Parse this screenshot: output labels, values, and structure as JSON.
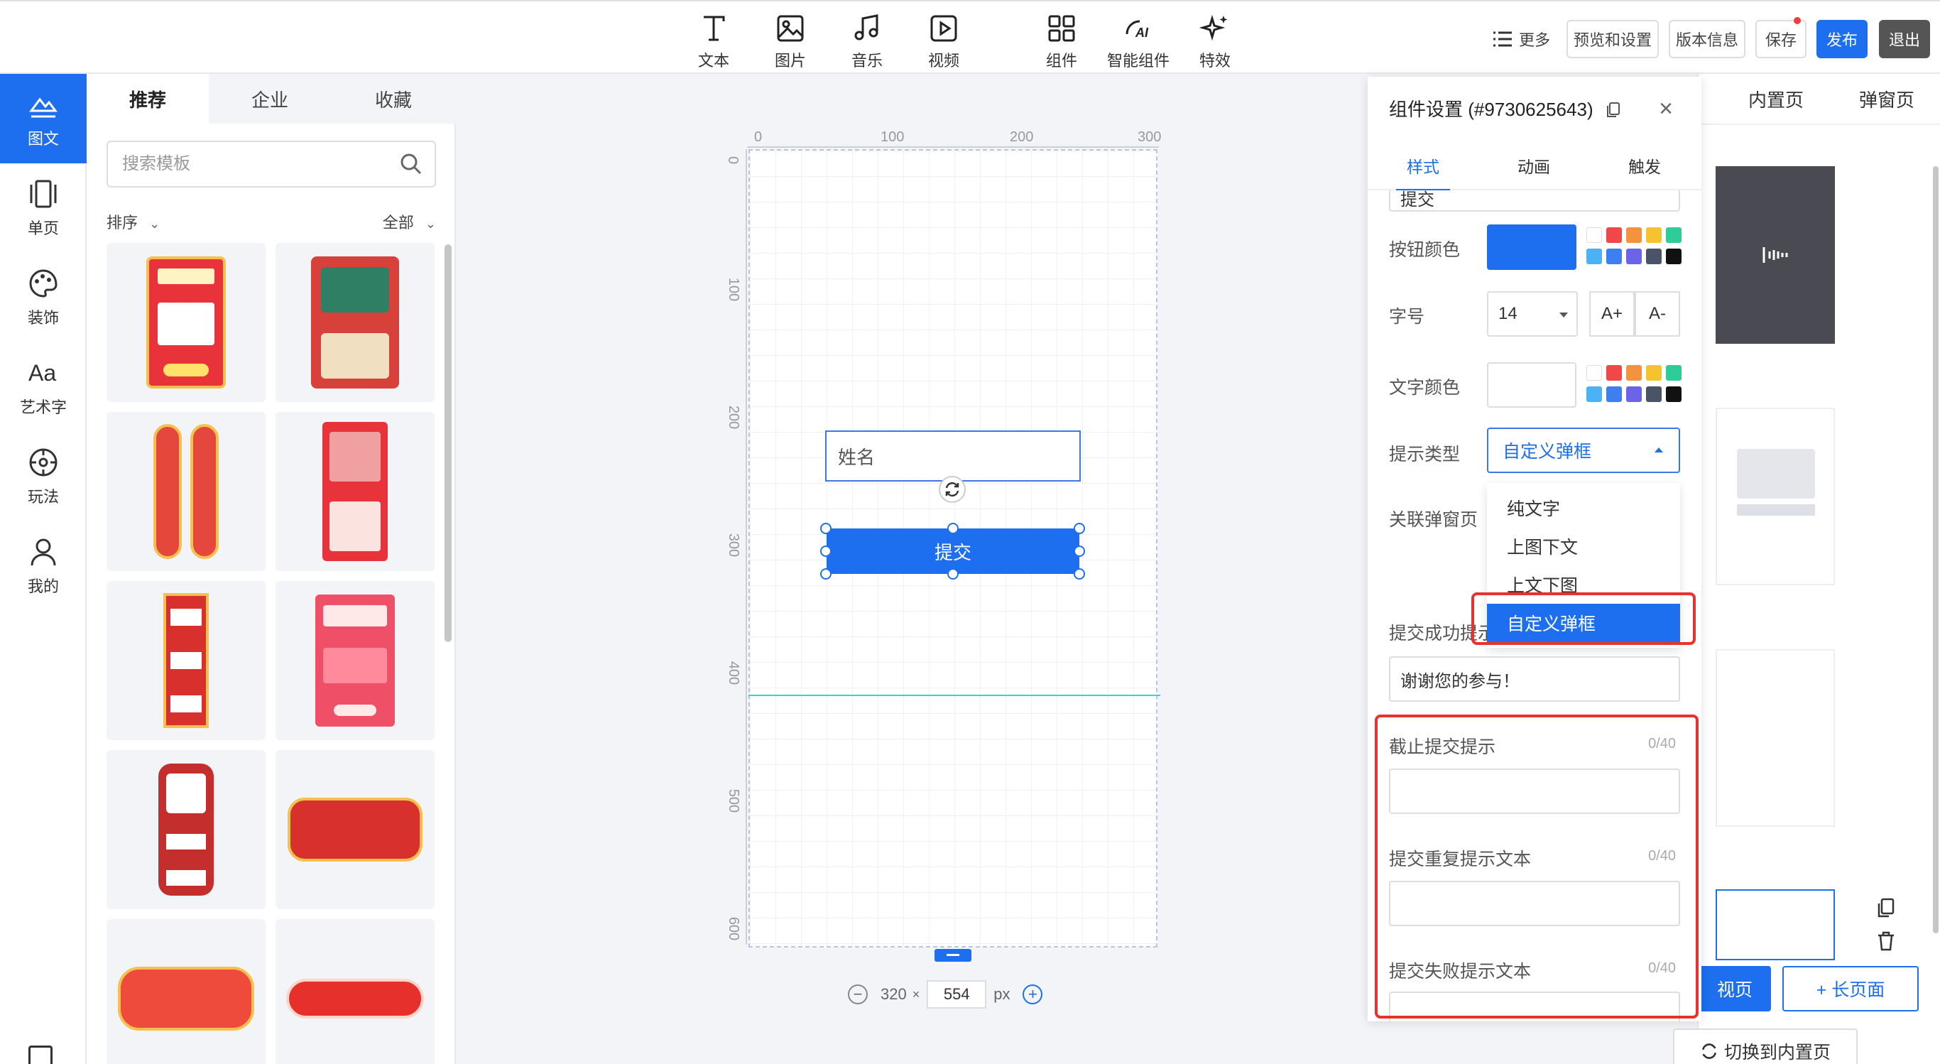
{
  "toolbar": {
    "tools": [
      {
        "label": "文本",
        "icon": "text-icon"
      },
      {
        "label": "图片",
        "icon": "image-icon"
      },
      {
        "label": "音乐",
        "icon": "music-icon"
      },
      {
        "label": "视频",
        "icon": "video-icon"
      },
      {
        "label": "组件",
        "icon": "component-icon"
      },
      {
        "label": "智能组件",
        "icon": "ai-icon"
      },
      {
        "label": "特效",
        "icon": "sparkle-icon"
      }
    ],
    "more": "更多",
    "preview": "预览和设置",
    "version": "版本信息",
    "save": "保存",
    "publish": "发布",
    "exit": "退出"
  },
  "leftnav": {
    "items": [
      {
        "label": "图文",
        "icon": "image-text-icon",
        "active": true
      },
      {
        "label": "单页",
        "icon": "page-icon"
      },
      {
        "label": "装饰",
        "icon": "palette-icon"
      },
      {
        "label": "艺术字",
        "icon": "art-text-icon"
      },
      {
        "label": "玩法",
        "icon": "play-icon"
      },
      {
        "label": "我的",
        "icon": "user-icon"
      }
    ],
    "accent": "#1d6ff0"
  },
  "templates": {
    "tabs": [
      "推荐",
      "企业",
      "收藏"
    ],
    "active_tab": "推荐",
    "search_placeholder": "搜索模板",
    "sort": "排序",
    "filter": "全部"
  },
  "canvas": {
    "ruler_top": [
      "0",
      "100",
      "200",
      "300"
    ],
    "ruler_left": [
      "0",
      "100",
      "200",
      "300",
      "400",
      "500",
      "600"
    ],
    "name_placeholder": "姓名",
    "submit_label": "提交",
    "width": "320",
    "times": "×",
    "height": "554",
    "unit": "px"
  },
  "settings": {
    "title": "组件设置 (#9730625643)",
    "tabs": [
      "样式",
      "动画",
      "触发"
    ],
    "active_tab": "样式",
    "partial_input": "提交",
    "button_color_label": "按钮颜色",
    "button_color": "#1d6ff0",
    "font_size_label": "字号",
    "font_size": "14",
    "font_inc": "A+",
    "font_dec": "A-",
    "text_color_label": "文字颜色",
    "prompt_type_label": "提示类型",
    "prompt_type_value": "自定义弹框",
    "prompt_options": [
      "纯文字",
      "上图下文",
      "上文下图",
      "自定义弹框"
    ],
    "linked_popup_label": "关联弹窗页",
    "success_label": "提交成功提示",
    "success_value": "谢谢您的参与！",
    "deadline_label": "截止提交提示",
    "deadline_count": "0/40",
    "duplicate_label": "提交重复提示文本",
    "duplicate_count": "0/40",
    "fail_label": "提交失败提示文本",
    "fail_count": "0/40",
    "swatches_row1": [
      "#ffffff",
      "#f04848",
      "#f5923e",
      "#f5c230",
      "#2dcc9a"
    ],
    "swatches_row2": [
      "#4bb3f5",
      "#3d7ef0",
      "#6b63e8",
      "#4a5468",
      "#111111"
    ]
  },
  "pages": {
    "tabs": [
      "内置页",
      "弹窗页"
    ],
    "short_page_btn": "视页",
    "long_page_btn": "+ 长页面",
    "switch_btn": "切换到内置页"
  }
}
